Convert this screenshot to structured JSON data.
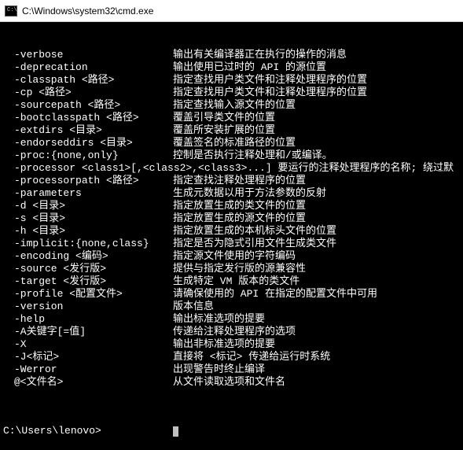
{
  "window": {
    "title": "C:\\Windows\\system32\\cmd.exe",
    "icon_label": "CMD"
  },
  "options": [
    {
      "flag": "-verbose",
      "desc": "输出有关编译器正在执行的操作的消息"
    },
    {
      "flag": "-deprecation",
      "desc": "输出使用已过时的 API 的源位置"
    },
    {
      "flag": "-classpath <路径>",
      "desc": "指定查找用户类文件和注释处理程序的位置"
    },
    {
      "flag": "-cp <路径>",
      "desc": "指定查找用户类文件和注释处理程序的位置"
    },
    {
      "flag": "-sourcepath <路径>",
      "desc": "指定查找输入源文件的位置"
    },
    {
      "flag": "-bootclasspath <路径>",
      "desc": "覆盖引导类文件的位置"
    },
    {
      "flag": "-extdirs <目录>",
      "desc": "覆盖所安装扩展的位置"
    },
    {
      "flag": "-endorseddirs <目录>",
      "desc": "覆盖签名的标准路径的位置"
    },
    {
      "flag": "-proc:{none,only}",
      "desc": "控制是否执行注释处理和/或编译。"
    },
    {
      "flag": "-processor <class1>[,<class2>,<class3>...] 要运行的注释处理程序的名称; 绕过默",
      "desc": "",
      "full": true
    },
    {
      "flag": "-processorpath <路径>",
      "desc": "指定查找注释处理程序的位置"
    },
    {
      "flag": "-parameters",
      "desc": "生成元数据以用于方法参数的反射"
    },
    {
      "flag": "-d <目录>",
      "desc": "指定放置生成的类文件的位置"
    },
    {
      "flag": "-s <目录>",
      "desc": "指定放置生成的源文件的位置"
    },
    {
      "flag": "-h <目录>",
      "desc": "指定放置生成的本机标头文件的位置"
    },
    {
      "flag": "-implicit:{none,class}",
      "desc": "指定是否为隐式引用文件生成类文件"
    },
    {
      "flag": "-encoding <编码>",
      "desc": "指定源文件使用的字符编码"
    },
    {
      "flag": "-source <发行版>",
      "desc": "提供与指定发行版的源兼容性"
    },
    {
      "flag": "-target <发行版>",
      "desc": "生成特定 VM 版本的类文件"
    },
    {
      "flag": "-profile <配置文件>",
      "desc": "请确保使用的 API 在指定的配置文件中可用"
    },
    {
      "flag": "-version",
      "desc": "版本信息"
    },
    {
      "flag": "-help",
      "desc": "输出标准选项的提要"
    },
    {
      "flag": "-A关键字[=值]",
      "desc": "传递给注释处理程序的选项"
    },
    {
      "flag": "-X",
      "desc": "输出非标准选项的提要"
    },
    {
      "flag": "-J<标记>",
      "desc": "直接将 <标记> 传递给运行时系统"
    },
    {
      "flag": "-Werror",
      "desc": "出现警告时终止编译"
    },
    {
      "flag": "@<文件名>",
      "desc": "从文件读取选项和文件名"
    }
  ],
  "prompt": "C:\\Users\\lenovo>"
}
